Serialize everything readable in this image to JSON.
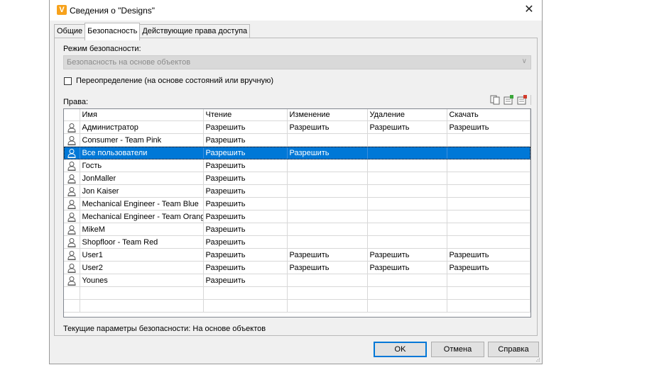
{
  "window": {
    "title": "Сведения о \"Designs\"",
    "app_icon": "V",
    "close_glyph": "✕"
  },
  "tabs": [
    {
      "label": "Общие",
      "active": false
    },
    {
      "label": "Безопасность",
      "active": true
    },
    {
      "label": "Действующие права доступа",
      "active": false
    }
  ],
  "security": {
    "mode_label": "Режим безопасности:",
    "mode_value": "Безопасность на основе объектов",
    "override_label": "Переопределение (на основе состояний или вручную)",
    "override_checked": false,
    "rights_label": "Права:",
    "toolbar_icons": [
      "copy-icon",
      "add-permission-icon",
      "remove-permission-icon"
    ]
  },
  "grid": {
    "columns": [
      "Имя",
      "Чтение",
      "Изменение",
      "Удаление",
      "Скачать"
    ],
    "rows": [
      {
        "name": "Администратор",
        "read": "Разрешить",
        "modify": "Разрешить",
        "delete": "Разрешить",
        "download": "Разрешить"
      },
      {
        "name": "Consumer - Team Pink",
        "read": "Разрешить",
        "modify": "",
        "delete": "",
        "download": ""
      },
      {
        "name": "Все пользователи",
        "read": "Разрешить",
        "modify": "Разрешить",
        "delete": "",
        "download": "",
        "selected": true
      },
      {
        "name": "Гость",
        "read": "Разрешить",
        "modify": "",
        "delete": "",
        "download": ""
      },
      {
        "name": "JonMaller",
        "read": "Разрешить",
        "modify": "",
        "delete": "",
        "download": ""
      },
      {
        "name": "Jon Kaiser",
        "read": "Разрешить",
        "modify": "",
        "delete": "",
        "download": ""
      },
      {
        "name": "Mechanical Engineer - Team Blue",
        "read": "Разрешить",
        "modify": "",
        "delete": "",
        "download": ""
      },
      {
        "name": "Mechanical Engineer - Team Orange",
        "read": "Разрешить",
        "modify": "",
        "delete": "",
        "download": ""
      },
      {
        "name": "MikeM",
        "read": "Разрешить",
        "modify": "",
        "delete": "",
        "download": ""
      },
      {
        "name": "Shopfloor - Team Red",
        "read": "Разрешить",
        "modify": "",
        "delete": "",
        "download": ""
      },
      {
        "name": "User1",
        "read": "Разрешить",
        "modify": "Разрешить",
        "delete": "Разрешить",
        "download": "Разрешить"
      },
      {
        "name": "User2",
        "read": "Разрешить",
        "modify": "Разрешить",
        "delete": "Разрешить",
        "download": "Разрешить"
      },
      {
        "name": "Younes",
        "read": "Разрешить",
        "modify": "",
        "delete": "",
        "download": ""
      }
    ]
  },
  "footer": {
    "status_text": "Текущие параметры безопасности: На основе объектов"
  },
  "buttons": {
    "ok": "OK",
    "cancel": "Отмена",
    "help": "Справка"
  },
  "colors": {
    "selection": "#0078d7",
    "app_icon": "#f7a21b"
  }
}
